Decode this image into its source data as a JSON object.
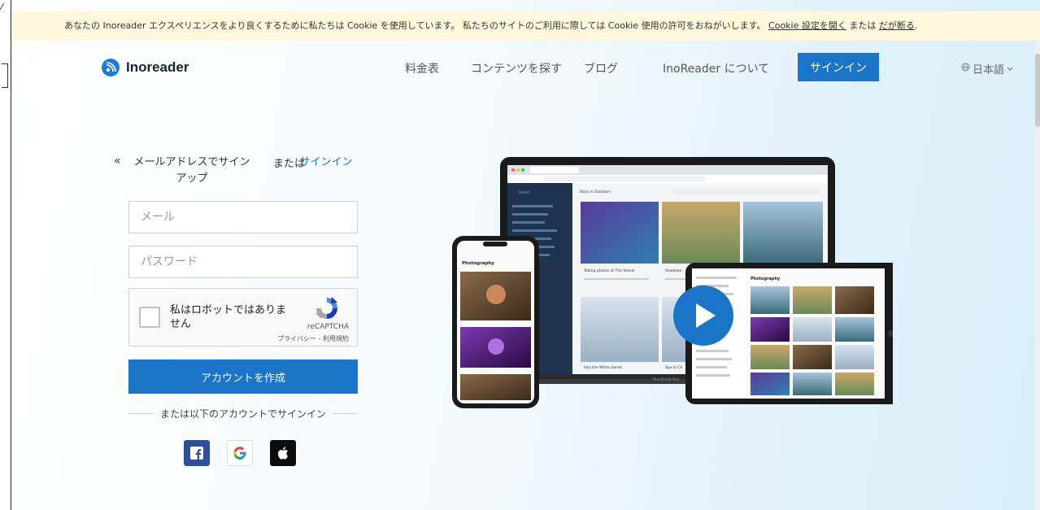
{
  "cookie_banner": {
    "text": "あなたの Inoreader エクスペリエンスをより良くするために私たちは Cookie を使用しています。 私たちのサイトのご利用に際しては Cookie 使用の許可をおねがいします。",
    "settings_link": "Cookie 設定を開く",
    "or_text": "または",
    "decline_link": "だが断る",
    "end_text": "."
  },
  "header": {
    "brand": "Inoreader",
    "nav": [
      "料金表",
      "コンテンツを探す",
      "ブログ",
      "InoReader について"
    ],
    "signin_button": "サインイン",
    "language": "日本語"
  },
  "signup": {
    "back": "«",
    "mode_title": "メールアドレスでサインアップ",
    "or": "または",
    "signin_link": "サインイン",
    "email_placeholder": "メール",
    "password_placeholder": "パスワード",
    "captcha": {
      "label": "私はロボットではありません",
      "brand": "reCAPTCHA",
      "links": "プライバシー - 利用規約"
    },
    "create_button": "アカウントを作成",
    "divider_text": "または以下のアカウントでサインイン",
    "social": [
      "facebook",
      "google",
      "apple"
    ]
  },
  "colors": {
    "accent": "#1a75c8",
    "cookie_bg": "#fff8dc",
    "facebook": "#2d4f9e",
    "apple": "#0c0c0c"
  },
  "hero": {
    "device_mockup": {
      "laptop": {
        "sidebar_label": "Search",
        "header_title": "Back in Outdoors",
        "cards": [
          "Taking photos at The Vessel",
          "Shadows",
          "Into the White Sands",
          "Spa in Ch"
        ],
        "model_label": "MacBook Pro"
      },
      "phone": {
        "title": "Photography"
      },
      "tablet": {
        "title": "Photography"
      }
    }
  }
}
